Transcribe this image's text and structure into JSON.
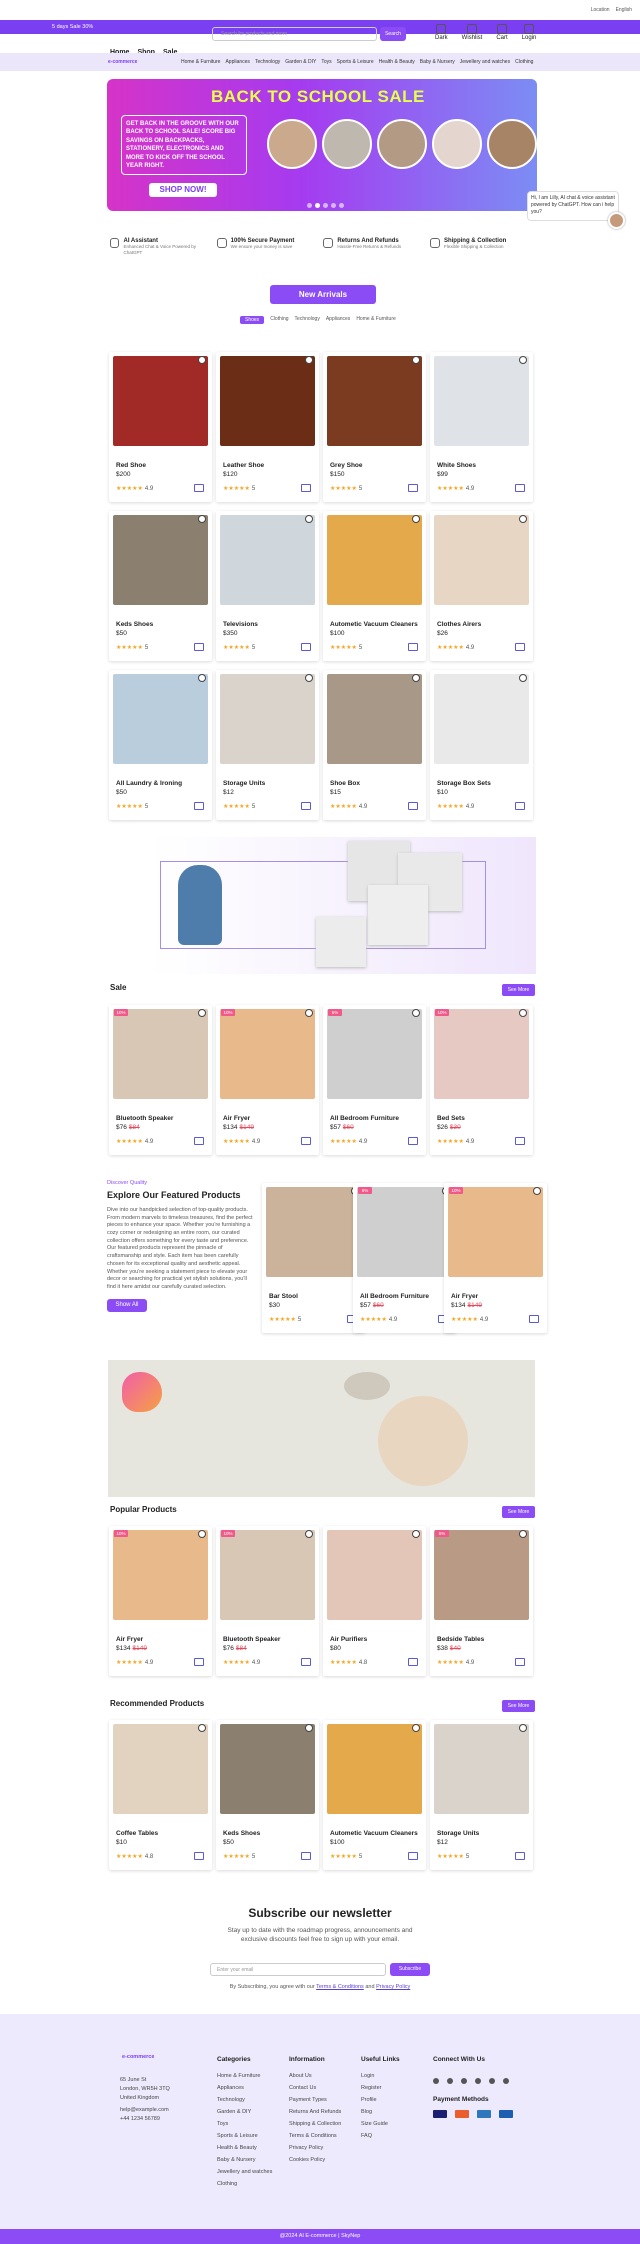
{
  "topbar": {
    "location": "Location",
    "language": "English"
  },
  "promo": {
    "text": "5 days Sale 30%"
  },
  "header": {
    "nav": [
      "Home",
      "Shop",
      "Sale"
    ],
    "search_placeholder": "Search for products and more",
    "search_button": "Search",
    "icons": [
      "Dark",
      "Wishlist",
      "Cart",
      "Login"
    ]
  },
  "catbar": {
    "logo": "e-commerce",
    "categories": [
      "Home & Furniture",
      "Appliances",
      "Technology",
      "Garden & DIY",
      "Toys",
      "Sports & Leisure",
      "Health & Beauty",
      "Baby & Nursery",
      "Jewellery and watches",
      "Clothing"
    ]
  },
  "hero": {
    "title": "BACK TO SCHOOL SALE",
    "text": "GET BACK IN THE GROOVE WITH OUR BACK TO SCHOOL SALE! SCORE BIG SAVINGS ON BACKPACKS, STATIONERY, ELECTRONICS AND MORE TO KICK OFF THE SCHOOL YEAR RIGHT.",
    "button": "SHOP NOW!"
  },
  "features": [
    {
      "title": "AI Assistant",
      "sub": "Enhanced Chat & Voice Powered by ChatGPT"
    },
    {
      "title": "100% Secure Payment",
      "sub": "We ensure your money is save"
    },
    {
      "title": "Returns And Refunds",
      "sub": "Hassle-Free Returns & Refunds"
    },
    {
      "title": "Shipping & Collection",
      "sub": "Flexible Shipping & Collection"
    }
  ],
  "new_arrivals": {
    "title": "New Arrivals",
    "tabs": [
      "Shoes",
      "Clothing",
      "Technology",
      "Appliances",
      "Home & Furniture"
    ],
    "products": [
      {
        "name": "Red Shoe",
        "price": "$200",
        "rating": "4.9",
        "stars": "★★★★★",
        "color": "#a12a26"
      },
      {
        "name": "Leather Shoe",
        "price": "$120",
        "rating": "5",
        "stars": "★★★★★",
        "color": "#6b2d16"
      },
      {
        "name": "Grey Shoe",
        "price": "$150",
        "rating": "5",
        "stars": "★★★★★",
        "color": "#7a3b20"
      },
      {
        "name": "White Shoes",
        "price": "$99",
        "rating": "4.9",
        "stars": "★★★★★",
        "color": "#dfe2e6"
      },
      {
        "name": "Keds Shoes",
        "price": "$50",
        "rating": "5",
        "stars": "★★★★★",
        "color": "#8b8070"
      },
      {
        "name": "Televisions",
        "price": "$350",
        "rating": "5",
        "stars": "★★★★★",
        "color": "#cfd6dc"
      },
      {
        "name": "Autometic Vacuum Cleaners",
        "price": "$100",
        "rating": "5",
        "stars": "★★★★★",
        "color": "#e3a94a"
      },
      {
        "name": "Clothes Airers",
        "price": "$26",
        "rating": "4.9",
        "stars": "★★★★★",
        "color": "#e8d6c4"
      },
      {
        "name": "All Laundry & Ironing",
        "price": "$50",
        "rating": "5",
        "stars": "★★★★★",
        "color": "#b9cddd"
      },
      {
        "name": "Storage Units",
        "price": "$12",
        "rating": "5",
        "stars": "★★★★★",
        "color": "#d9d3cb"
      },
      {
        "name": "Shoe Box",
        "price": "$15",
        "rating": "4.9",
        "stars": "★★★★★",
        "color": "#a89888"
      },
      {
        "name": "Storage Box Sets",
        "price": "$10",
        "rating": "4.9",
        "stars": "★★★★★",
        "color": "#e9e9e9"
      }
    ]
  },
  "sale": {
    "title": "Sale",
    "see_more": "See More",
    "products": [
      {
        "badge": "10%",
        "name": "Bluetooth Speaker",
        "price": "$76",
        "old": "$84",
        "rating": "4.9",
        "stars": "★★★★★",
        "color": "#d9c7b6"
      },
      {
        "badge": "10%",
        "name": "Air Fryer",
        "price": "$134",
        "old": "$149",
        "rating": "4.9",
        "stars": "★★★★★",
        "color": "#e8b98a"
      },
      {
        "badge": "5%",
        "name": "All Bedroom Furniture",
        "price": "$57",
        "old": "$60",
        "rating": "4.9",
        "stars": "★★★★★",
        "color": "#cfcfcf"
      },
      {
        "badge": "10%",
        "name": "Bed Sets",
        "price": "$26",
        "old": "$30",
        "rating": "4.9",
        "stars": "★★★★★",
        "color": "#e7c9c4"
      }
    ]
  },
  "featured": {
    "label": "Discover Quality",
    "title": "Explore Our Featured Products",
    "text": "Dive into our handpicked selection of top-quality products. From modern marvels to timeless treasures, find the perfect pieces to enhance your space. Whether you're furnishing a cozy corner or redesigning an entire room, our curated collection offers something for every taste and preference. Our featured products represent the pinnacle of craftsmanship and style. Each item has been carefully chosen for its exceptional quality and aesthetic appeal. Whether you're seeking a statement piece to elevate your decor or searching for practical yet stylish solutions, you'll find it here amidst our carefully curated selection.",
    "button": "Show All",
    "products": [
      {
        "badge": "",
        "name": "Bar Stool",
        "price": "$30",
        "old": "",
        "rating": "5",
        "stars": "★★★★★",
        "color": "#cbb29a"
      },
      {
        "badge": "5%",
        "name": "All Bedroom Furniture",
        "price": "$57",
        "old": "$60",
        "rating": "4.9",
        "stars": "★★★★★",
        "color": "#cfcfcf"
      },
      {
        "badge": "10%",
        "name": "Air Fryer",
        "price": "$134",
        "old": "$149",
        "rating": "4.9",
        "stars": "★★★★★",
        "color": "#e8b98a"
      }
    ]
  },
  "popular": {
    "title": "Popular Products",
    "see_more": "See More",
    "products": [
      {
        "badge": "10%",
        "name": "Air Fryer",
        "price": "$134",
        "old": "$149",
        "rating": "4.9",
        "stars": "★★★★★",
        "color": "#e8b98a"
      },
      {
        "badge": "10%",
        "name": "Bluetooth Speaker",
        "price": "$76",
        "old": "$84",
        "rating": "4.9",
        "stars": "★★★★★",
        "color": "#d9c7b6"
      },
      {
        "badge": "",
        "name": "Air Purifiers",
        "price": "$80",
        "old": "",
        "rating": "4.8",
        "stars": "★★★★★",
        "color": "#e4c6b8"
      },
      {
        "badge": "5%",
        "name": "Bedside Tables",
        "price": "$38",
        "old": "$40",
        "rating": "4.9",
        "stars": "★★★★★",
        "color": "#b89a85"
      }
    ]
  },
  "recommended": {
    "title": "Recommended Products",
    "see_more": "See More",
    "products": [
      {
        "name": "Coffee Tables",
        "price": "$10",
        "rating": "4.8",
        "stars": "★★★★★",
        "color": "#e2d3c0"
      },
      {
        "name": "Keds Shoes",
        "price": "$50",
        "rating": "5",
        "stars": "★★★★★",
        "color": "#8b8070"
      },
      {
        "name": "Autometic Vacuum Cleaners",
        "price": "$100",
        "rating": "5",
        "stars": "★★★★★",
        "color": "#e3a94a"
      },
      {
        "name": "Storage Units",
        "price": "$12",
        "rating": "5",
        "stars": "★★★★★",
        "color": "#d9d3cb"
      }
    ]
  },
  "newsletter": {
    "title": "Subscribe our newsletter",
    "text1": "Stay up to date with the roadmap progress, announcements and",
    "text2": "exclusive discounts feel free to sign up with your email.",
    "placeholder": "Enter your email",
    "button": "Subscribe",
    "agree_prefix": "By Subscribing, you agree with our",
    "terms": "Terms & Conditions",
    "and": "and",
    "privacy": "Privacy Policy"
  },
  "chat": {
    "text": "Hi, I am Lilly, AI chat & voice assistant powered by ChatGPT. How can i help you?"
  },
  "footer": {
    "logo": "e-commerce",
    "address": [
      "65 June St",
      "London, WR5H 3TQ",
      "United Kingdom"
    ],
    "email": "help@example.com",
    "phone": "+44 1234 56789",
    "categories_title": "Categories",
    "categories": [
      "Home & Furniture",
      "Appliances",
      "Technology",
      "Garden & DIY",
      "Toys",
      "Sports & Leisure",
      "Health & Beauty",
      "Baby & Nursery",
      "Jewellery and watches",
      "Clothing"
    ],
    "information_title": "Information",
    "information": [
      "About Us",
      "Contact Us",
      "Payment Types",
      "Returns And Refunds",
      "Shipping & Collection",
      "Terms & Conditions",
      "Privacy Policy",
      "Cookies Policy"
    ],
    "links_title": "Useful Links",
    "links": [
      "Login",
      "Register",
      "Profile",
      "Blog",
      "Size Guide",
      "FAQ"
    ],
    "connect_title": "Connect With Us",
    "payment_title": "Payment Methods",
    "copyright": "@2024 AI E-commerce | SkyNep"
  }
}
